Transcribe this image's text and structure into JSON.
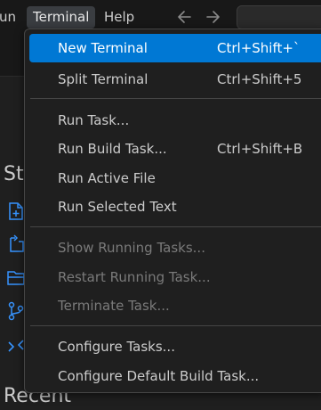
{
  "menubar": {
    "items": [
      {
        "label": "un"
      },
      {
        "label": "Terminal"
      },
      {
        "label": "Help"
      }
    ]
  },
  "nav": {
    "back_icon": "arrow-left-icon",
    "forward_icon": "arrow-right-icon"
  },
  "welcome": {
    "start_heading": "Sta",
    "recent_heading": "Recent",
    "icons": [
      "new-file-icon",
      "open-file-icon",
      "open-folder-icon",
      "git-clone-icon",
      "remote-connect-icon"
    ]
  },
  "terminal_menu": {
    "groups": [
      [
        {
          "label": "New Terminal",
          "shortcut": "Ctrl+Shift+`",
          "enabled": true,
          "highlighted": true
        },
        {
          "label": "Split Terminal",
          "shortcut": "Ctrl+Shift+5",
          "enabled": true
        }
      ],
      [
        {
          "label": "Run Task...",
          "shortcut": "",
          "enabled": true
        },
        {
          "label": "Run Build Task...",
          "shortcut": "Ctrl+Shift+B",
          "enabled": true
        },
        {
          "label": "Run Active File",
          "shortcut": "",
          "enabled": true
        },
        {
          "label": "Run Selected Text",
          "shortcut": "",
          "enabled": true
        }
      ],
      [
        {
          "label": "Show Running Tasks...",
          "shortcut": "",
          "enabled": false
        },
        {
          "label": "Restart Running Task...",
          "shortcut": "",
          "enabled": false
        },
        {
          "label": "Terminate Task...",
          "shortcut": "",
          "enabled": false
        }
      ],
      [
        {
          "label": "Configure Tasks...",
          "shortcut": "",
          "enabled": true
        },
        {
          "label": "Configure Default Build Task...",
          "shortcut": "",
          "enabled": true
        }
      ]
    ]
  },
  "colors": {
    "accent": "#0078d4",
    "icon_blue": "#3794ff",
    "menu_bg": "#1f1f1f",
    "text": "#cccccc",
    "disabled_text": "#7a7a7a"
  }
}
